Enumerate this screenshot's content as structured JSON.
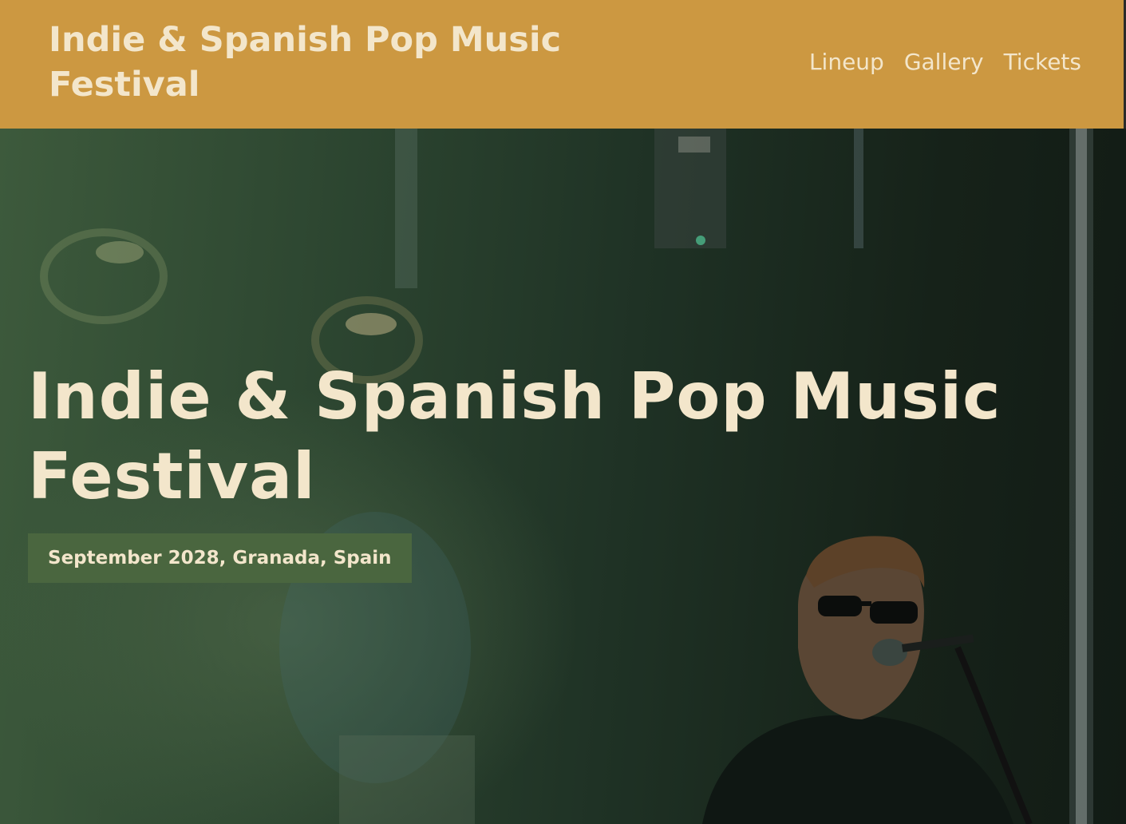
{
  "header": {
    "brand": "Indie & Spanish Pop Music Festival",
    "nav": [
      {
        "label": "Lineup"
      },
      {
        "label": "Gallery"
      },
      {
        "label": "Tickets"
      }
    ]
  },
  "hero": {
    "title": "Indie & Spanish Pop Music Festival",
    "date_location": "September 2028, Granada, Spain"
  },
  "colors": {
    "header_bg": "#cc9841",
    "text_cream": "#f3e6cb",
    "badge_green": "#4a663f"
  }
}
